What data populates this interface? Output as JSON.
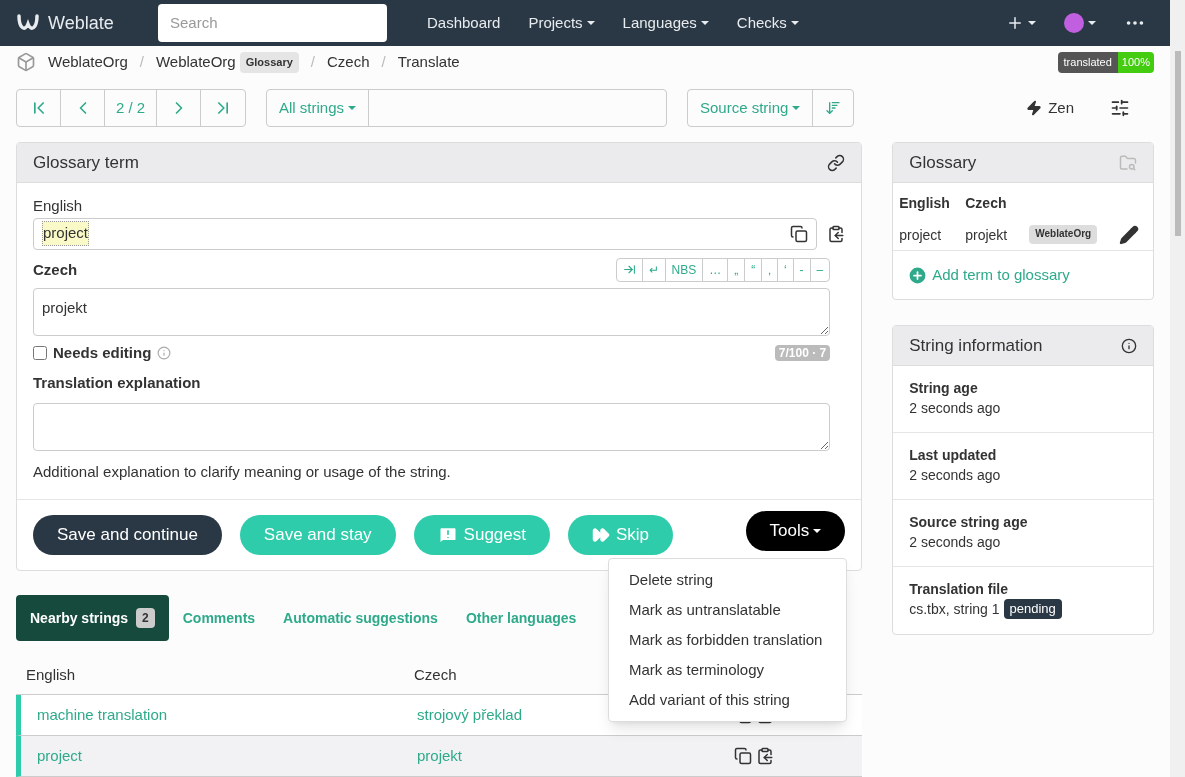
{
  "navbar": {
    "brand": "Weblate",
    "search": {
      "placeholder": "Search"
    },
    "menus": [
      {
        "label": "Dashboard",
        "dropdown": false
      },
      {
        "label": "Projects",
        "dropdown": true
      },
      {
        "label": "Languages",
        "dropdown": true
      },
      {
        "label": "Checks",
        "dropdown": true
      }
    ]
  },
  "breadcrumb_separator": "/",
  "breadcrumb": [
    {
      "label": "WeblateOrg"
    },
    {
      "label": "WeblateOrg",
      "badge": "Glossary"
    },
    {
      "label": "Czech"
    },
    {
      "label": "Translate"
    }
  ],
  "status_badge": {
    "label": "translated",
    "value": "100%"
  },
  "toolbar": {
    "position": "2 / 2",
    "filter": "All strings",
    "sort": "Source string",
    "zen": "Zen"
  },
  "editor": {
    "title": "Glossary term",
    "source_label": "English",
    "source_text": "project",
    "target_label": "Czech",
    "special_chars": [
      "↵",
      "NBS",
      "…",
      "„",
      "“",
      "‚",
      "‘",
      "-",
      "–"
    ],
    "target_text": "projekt",
    "needs_editing": {
      "label": "Needs editing",
      "checked": false
    },
    "counter": "7/100 · 7",
    "explanation_label": "Translation explanation",
    "explanation_help": "Additional explanation to clarify meaning or usage of the string.",
    "buttons": [
      {
        "label": "Save and continue",
        "kind": "primary"
      },
      {
        "label": "Save and stay",
        "kind": "secondary"
      },
      {
        "label": "Suggest",
        "kind": "suggest"
      },
      {
        "label": "Skip",
        "kind": "skip"
      }
    ],
    "tools": "Tools"
  },
  "tools_menu": [
    "Delete string",
    "Mark as untranslatable",
    "Mark as forbidden translation",
    "Mark as terminology",
    "Add variant of this string"
  ],
  "tabs": [
    {
      "label": "Nearby strings",
      "badge": "2",
      "selected": true
    },
    {
      "label": "Comments",
      "selected": false
    },
    {
      "label": "Automatic suggestions",
      "selected": false
    },
    {
      "label": "Other languages",
      "selected": false
    }
  ],
  "nearby": {
    "columns": [
      "English",
      "Czech"
    ],
    "rows": [
      {
        "source": "machine translation",
        "target": "strojový překlad",
        "selected": false
      },
      {
        "source": "project",
        "target": "projekt",
        "selected": true
      }
    ]
  },
  "glossary": {
    "title": "Glossary",
    "columns": [
      "English",
      "Czech"
    ],
    "rows": [
      {
        "source": "project",
        "target": "projekt",
        "tag": "WeblateOrg"
      }
    ],
    "add": "Add term to glossary"
  },
  "string_info": {
    "title": "String information",
    "items": [
      {
        "label": "String age",
        "value": "2 seconds ago"
      },
      {
        "label": "Last updated",
        "value": "2 seconds ago"
      },
      {
        "label": "Source string age",
        "value": "2 seconds ago"
      },
      {
        "label": "Translation file",
        "value": "cs.tbx, string 1",
        "badge": "pending"
      }
    ]
  }
}
